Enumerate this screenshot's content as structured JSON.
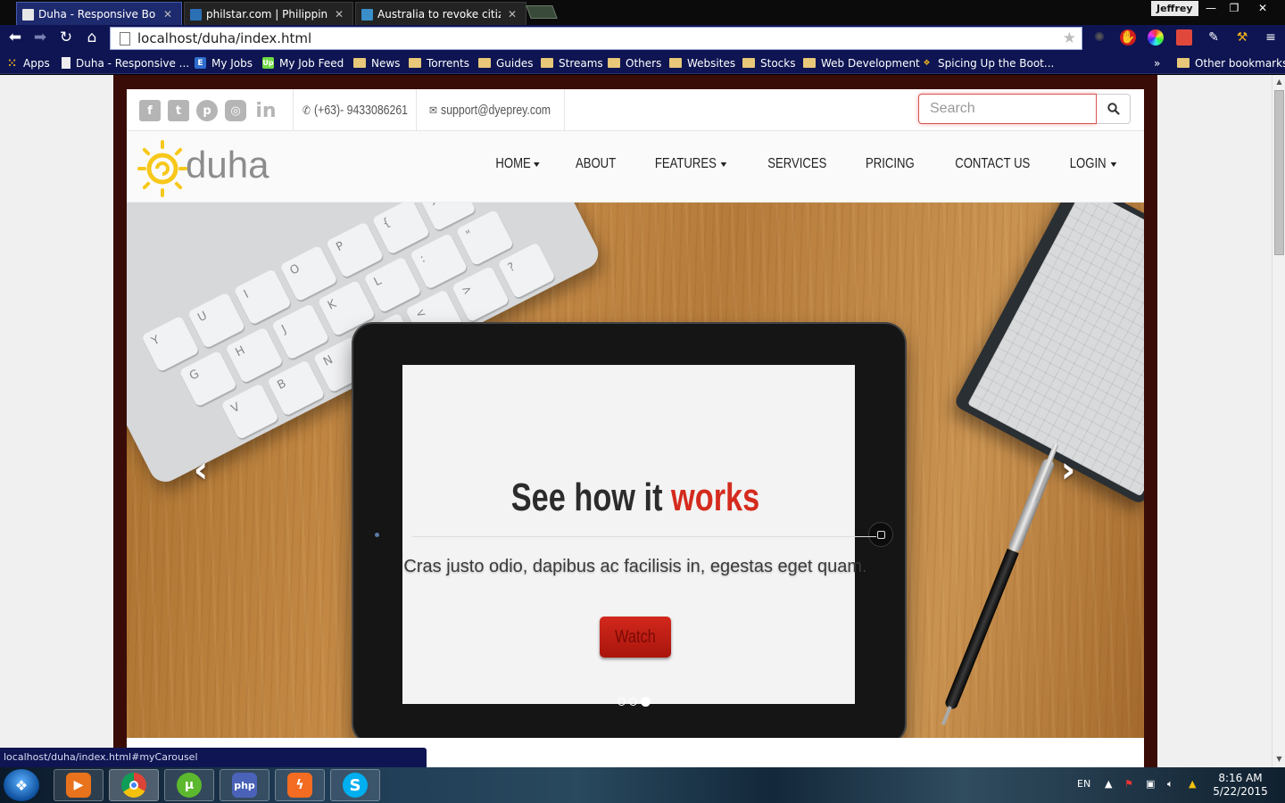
{
  "tabs": [
    {
      "title": "Duha - Responsive Bootst",
      "active": true
    },
    {
      "title": "philstar.com | Philippine N",
      "active": false
    },
    {
      "title": "Australia to revoke citizen",
      "active": false
    }
  ],
  "profile_name": "Jeffrey",
  "address_bar": {
    "url": "localhost/duha/index.html"
  },
  "bookmarks": [
    {
      "label": "Apps",
      "icon": "apps-grid-icon"
    },
    {
      "label": "Duha - Responsive ...",
      "icon": "page-icon"
    },
    {
      "label": "My Jobs",
      "icon": "elance-icon"
    },
    {
      "label": "My Job Feed",
      "icon": "upwork-icon"
    },
    {
      "label": "News",
      "icon": "folder-icon"
    },
    {
      "label": "Torrents",
      "icon": "folder-icon"
    },
    {
      "label": "Guides",
      "icon": "folder-icon"
    },
    {
      "label": "Streams",
      "icon": "folder-icon"
    },
    {
      "label": "Others",
      "icon": "folder-icon"
    },
    {
      "label": "Websites",
      "icon": "folder-icon"
    },
    {
      "label": "Stocks",
      "icon": "folder-icon"
    },
    {
      "label": "Web Development",
      "icon": "folder-icon"
    },
    {
      "label": "Spicing Up the Boot...",
      "icon": "bookmark-icon"
    }
  ],
  "bookmarks_overflow": "»",
  "other_bookmarks": "Other bookmarks",
  "site": {
    "phone": "(+63)- 9433086261",
    "email": "support@dyeprey.com",
    "search_placeholder": "Search",
    "logo_text": "duha",
    "menu": [
      {
        "label": "HOME",
        "dropdown": true
      },
      {
        "label": "ABOUT",
        "dropdown": false
      },
      {
        "label": "FEATURES",
        "dropdown": true
      },
      {
        "label": "SERVICES",
        "dropdown": false
      },
      {
        "label": "PRICING",
        "dropdown": false
      },
      {
        "label": "CONTACT US",
        "dropdown": false
      },
      {
        "label": "LOGIN",
        "dropdown": true
      }
    ],
    "carousel": {
      "title_part1": "See how it",
      "title_accent": "works",
      "caption": "Cras justo odio, dapibus ac facilisis in, egestas eget quam.",
      "button_label": "Watch",
      "slide_count": 3,
      "active_slide": 3
    },
    "colors": {
      "accent_red": "#d42b1e",
      "frame": "#3a0c08",
      "search_border": "#d9534f"
    }
  },
  "status_url": "localhost/duha/index.html#myCarousel",
  "taskbar": {
    "language": "EN",
    "time": "8:16 AM",
    "date": "5/22/2015"
  }
}
